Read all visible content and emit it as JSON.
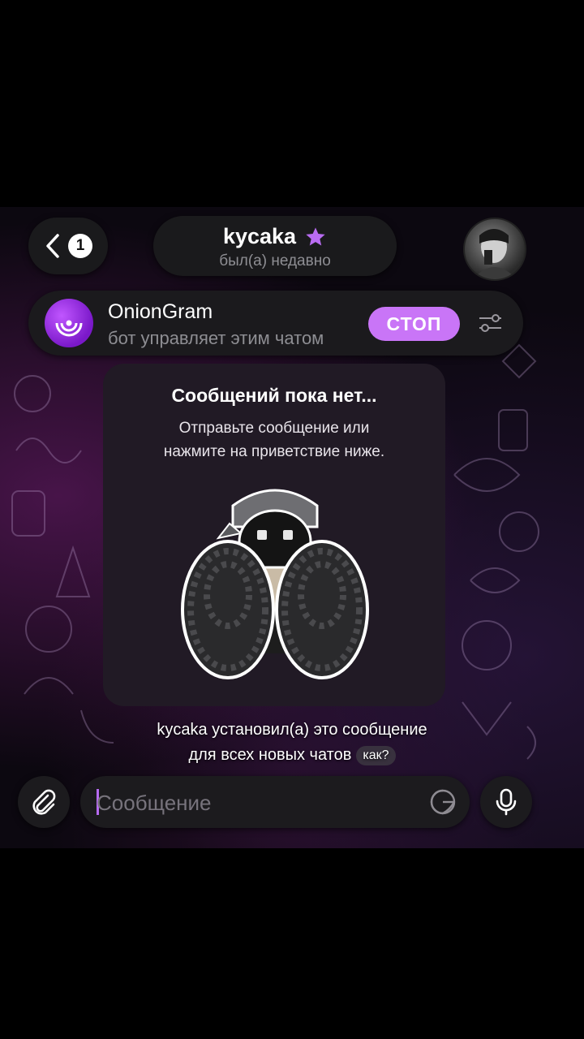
{
  "header": {
    "unread_count": "1",
    "chat_name": "kycaka",
    "status": "был(а) недавно"
  },
  "bot_bar": {
    "name": "OnionGram",
    "description": "бот управляет этим чатом",
    "stop_label": "СТОП"
  },
  "empty_state": {
    "title": "Сообщений пока нет...",
    "line1": "Отправьте сообщение или",
    "line2": "нажмите на приветствие ниже."
  },
  "notice": {
    "line1": "kycaka установил(а) это сообщение",
    "line2": "для всех новых чатов",
    "how_label": "как?"
  },
  "composer": {
    "placeholder": "Сообщение"
  },
  "icons": {
    "back": "chevron-left-icon",
    "premium": "star-icon",
    "bot_logo": "onion-logo-icon",
    "settings": "sliders-icon",
    "attach": "paperclip-icon",
    "sticker": "sticker-icon",
    "mic": "microphone-icon"
  },
  "colors": {
    "accent": "#c975f7",
    "star": "#b96cf2",
    "panel": "#1b1a1d",
    "card": "#211a25"
  }
}
